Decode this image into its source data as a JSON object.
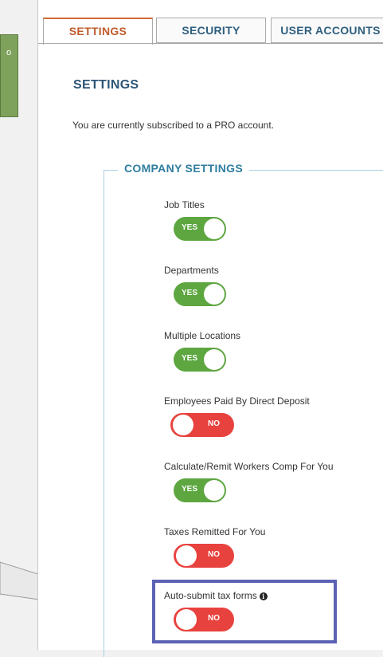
{
  "tabs": [
    {
      "label": "SETTINGS"
    },
    {
      "label": "SECURITY"
    },
    {
      "label": "USER ACCOUNTS"
    }
  ],
  "page_title": "SETTINGS",
  "subscription_text": "You are currently subscribed to a PRO account.",
  "section_title": "COMPANY SETTINGS",
  "settings": [
    {
      "label": "Job Titles",
      "value": "YES"
    },
    {
      "label": "Departments",
      "value": "YES"
    },
    {
      "label": "Multiple Locations",
      "value": "YES"
    },
    {
      "label": "Employees Paid By Direct Deposit",
      "value": "NO"
    },
    {
      "label": "Calculate/Remit Workers Comp For You",
      "value": "YES"
    },
    {
      "label": "Taxes Remitted For You",
      "value": "NO"
    },
    {
      "label": "Auto-submit tax forms",
      "value": "NO"
    }
  ],
  "callout": {
    "text": "o"
  },
  "colors": {
    "toggle_on": "#5da640",
    "toggle_off": "#e8423e",
    "active_tab": "#c05b2c",
    "heading": "#2d5575",
    "highlight": "#5c62b4"
  },
  "icons": {
    "info": "info-circle-icon"
  }
}
